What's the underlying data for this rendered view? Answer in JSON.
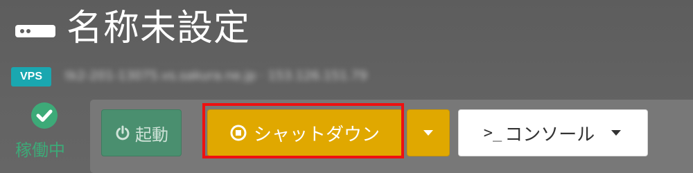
{
  "header": {
    "title": "名称未設定",
    "server_icon": "server-icon"
  },
  "server": {
    "type_badge": "VPS",
    "host_blurred": "tk2-201-13075.vs.sakura.ne.jp · 153.126.151.79"
  },
  "status": {
    "icon": "check-circle-icon",
    "label": "稼働中",
    "color": "#3daa78"
  },
  "toolbar": {
    "start_label": "起動",
    "start_icon": "power-icon",
    "shutdown_label": "シャットダウン",
    "shutdown_icon": "stop-circle-icon",
    "shutdown_menu_icon": "caret-down-icon",
    "console_prompt": ">_",
    "console_label": "コンソール",
    "console_menu_icon": "caret-down-icon"
  },
  "colors": {
    "background": "#5f5f5f",
    "toolbar": "#787878",
    "start": "#4a8f6f",
    "shutdown": "#e0a800",
    "badge": "#1aa7b0",
    "highlight": "#ee1111"
  }
}
